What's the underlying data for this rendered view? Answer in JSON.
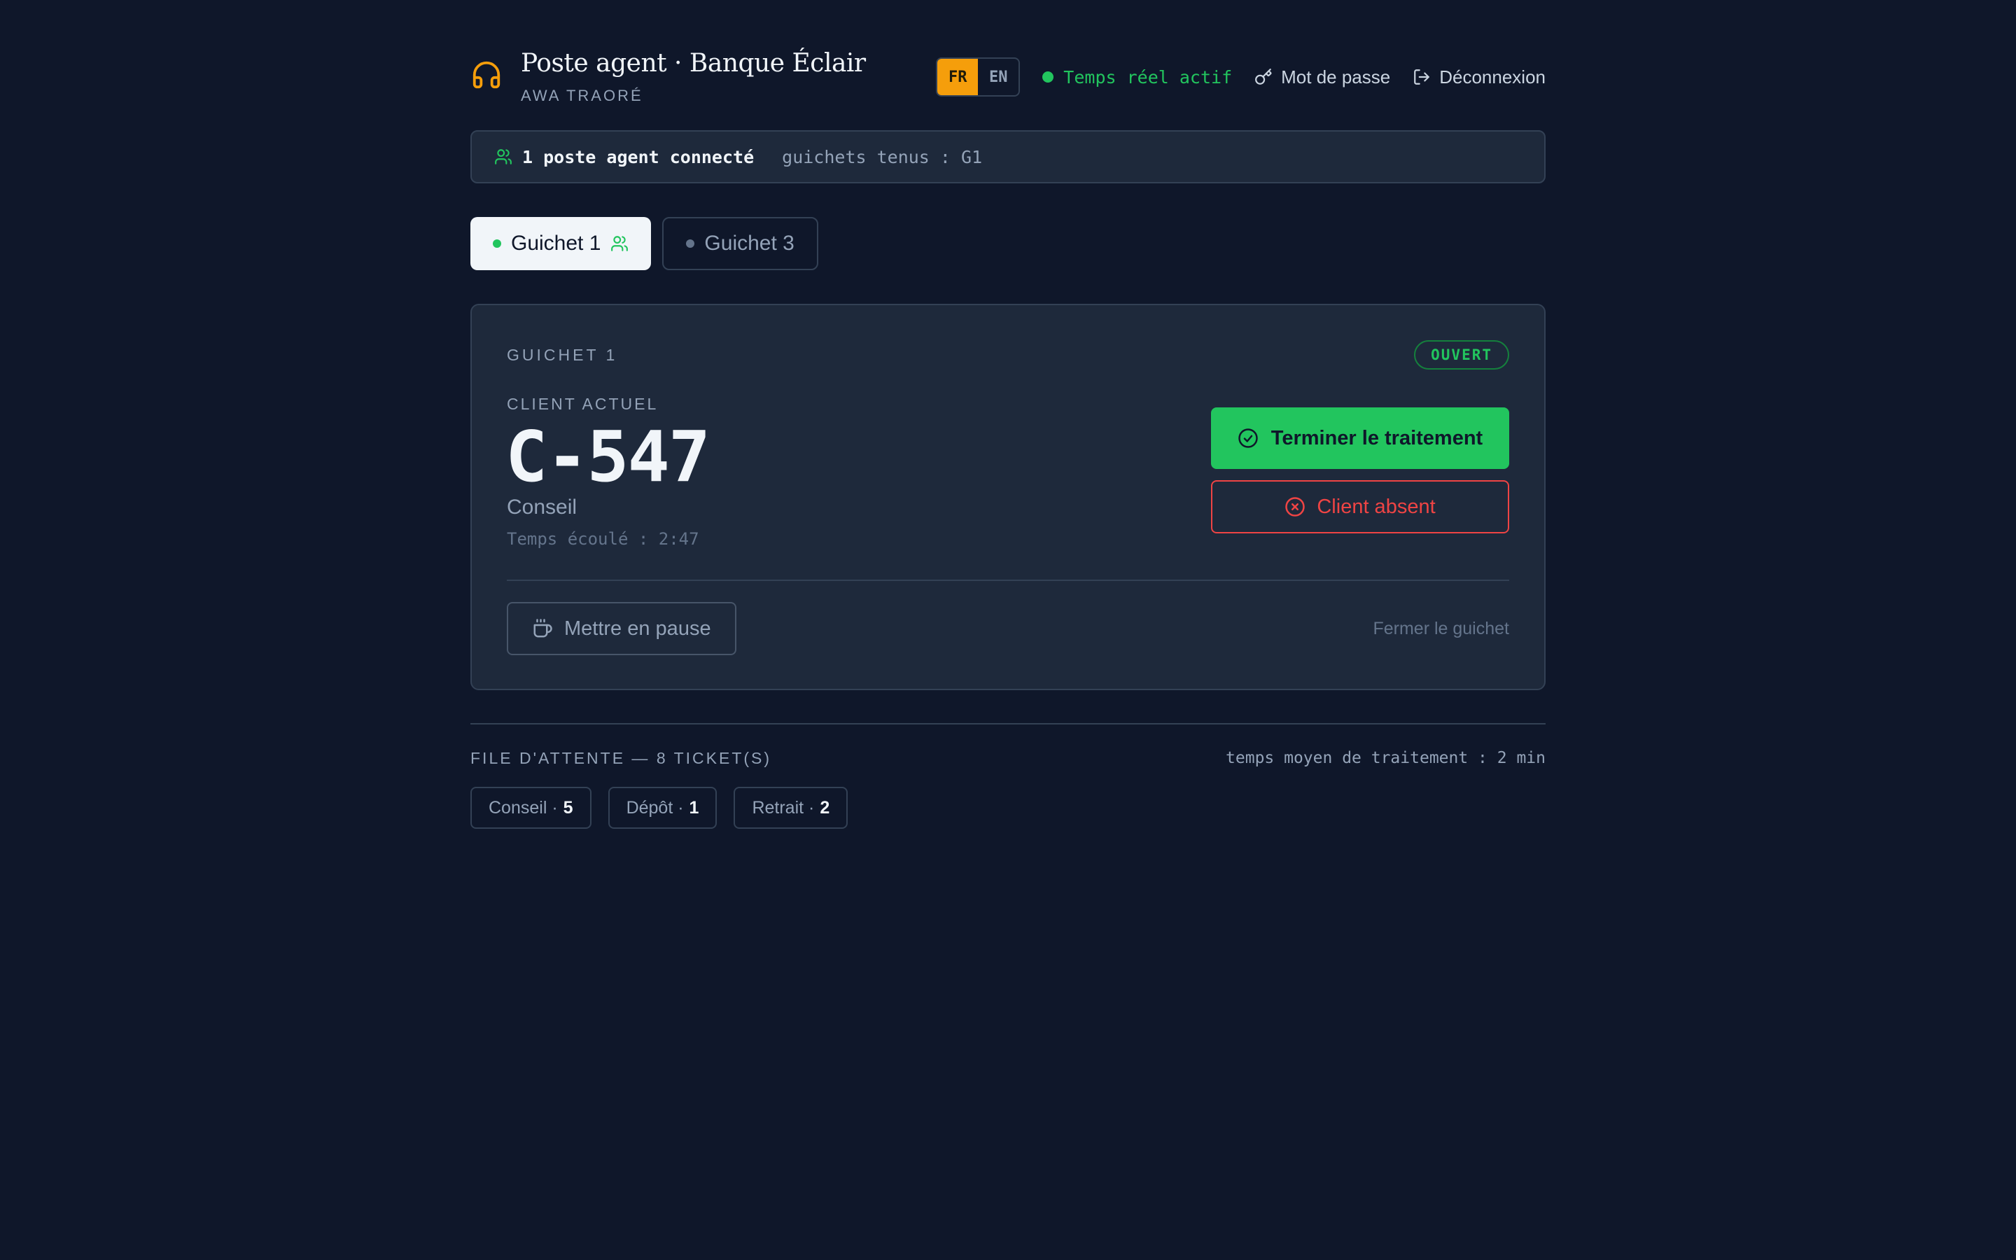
{
  "header": {
    "title": "Poste agent · Banque Éclair",
    "agent_name": "AWA TRAORÉ",
    "lang_fr": "FR",
    "lang_en": "EN",
    "live_status": "Temps réel actif",
    "password_link": "Mot de passe",
    "logout_link": "Déconnexion",
    "brand_icon": "headset-icon"
  },
  "presence": {
    "connected": "1 poste agent connecté",
    "held": "guichets tenus : G1"
  },
  "tabs": [
    {
      "label": "Guichet 1",
      "active": true
    },
    {
      "label": "Guichet 3",
      "active": false
    }
  ],
  "counter": {
    "label": "GUICHET 1",
    "status": "OUVERT",
    "current_label": "CLIENT ACTUEL",
    "ticket": "C-547",
    "service": "Conseil",
    "elapsed": "Temps écoulé : 2:47",
    "done_button": "Terminer le traitement",
    "absent_button": "Client absent",
    "pause_button": "Mettre en pause",
    "close_link": "Fermer le guichet"
  },
  "queue": {
    "title": "FILE D'ATTENTE — 8 TICKET(S)",
    "avg": "temps moyen de traitement : 2 min",
    "chips": [
      {
        "label": "Conseil · ",
        "count": "5"
      },
      {
        "label": "Dépôt · ",
        "count": "1"
      },
      {
        "label": "Retrait · ",
        "count": "2"
      }
    ]
  },
  "colors": {
    "background": "#0f172a",
    "panel": "#1e293b",
    "accent": "#f59e0b",
    "success": "#22c55e",
    "danger": "#ef4444"
  }
}
